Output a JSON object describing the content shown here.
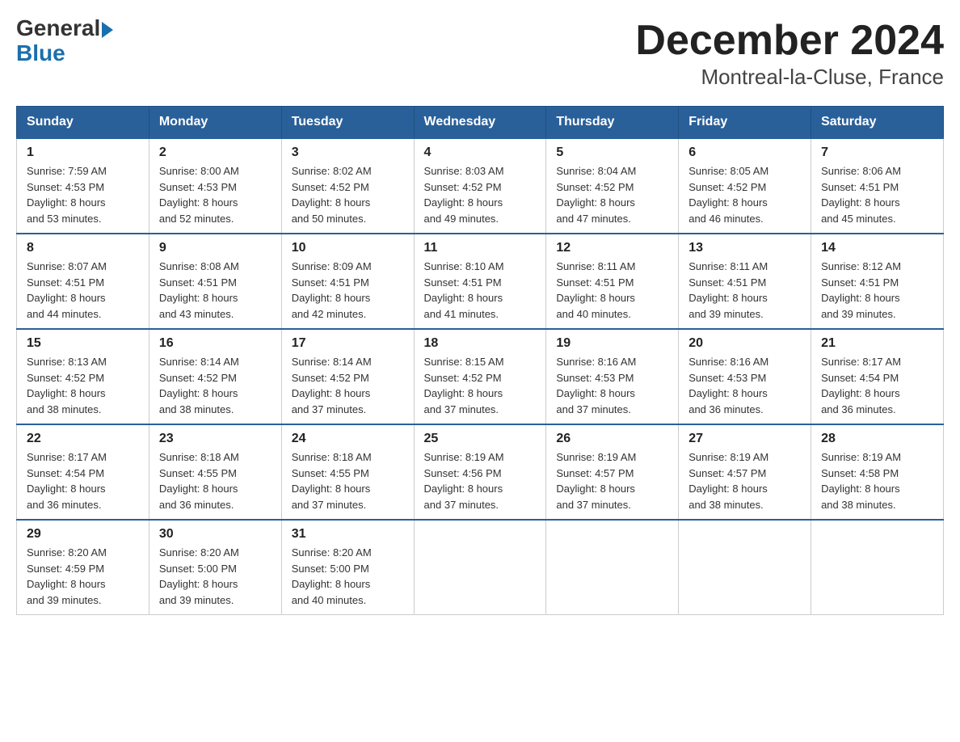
{
  "header": {
    "logo_general": "General",
    "logo_blue": "Blue",
    "title": "December 2024",
    "subtitle": "Montreal-la-Cluse, France"
  },
  "weekdays": [
    "Sunday",
    "Monday",
    "Tuesday",
    "Wednesday",
    "Thursday",
    "Friday",
    "Saturday"
  ],
  "weeks": [
    [
      {
        "day": "1",
        "sunrise": "Sunrise: 7:59 AM",
        "sunset": "Sunset: 4:53 PM",
        "daylight": "Daylight: 8 hours",
        "daylight2": "and 53 minutes."
      },
      {
        "day": "2",
        "sunrise": "Sunrise: 8:00 AM",
        "sunset": "Sunset: 4:53 PM",
        "daylight": "Daylight: 8 hours",
        "daylight2": "and 52 minutes."
      },
      {
        "day": "3",
        "sunrise": "Sunrise: 8:02 AM",
        "sunset": "Sunset: 4:52 PM",
        "daylight": "Daylight: 8 hours",
        "daylight2": "and 50 minutes."
      },
      {
        "day": "4",
        "sunrise": "Sunrise: 8:03 AM",
        "sunset": "Sunset: 4:52 PM",
        "daylight": "Daylight: 8 hours",
        "daylight2": "and 49 minutes."
      },
      {
        "day": "5",
        "sunrise": "Sunrise: 8:04 AM",
        "sunset": "Sunset: 4:52 PM",
        "daylight": "Daylight: 8 hours",
        "daylight2": "and 47 minutes."
      },
      {
        "day": "6",
        "sunrise": "Sunrise: 8:05 AM",
        "sunset": "Sunset: 4:52 PM",
        "daylight": "Daylight: 8 hours",
        "daylight2": "and 46 minutes."
      },
      {
        "day": "7",
        "sunrise": "Sunrise: 8:06 AM",
        "sunset": "Sunset: 4:51 PM",
        "daylight": "Daylight: 8 hours",
        "daylight2": "and 45 minutes."
      }
    ],
    [
      {
        "day": "8",
        "sunrise": "Sunrise: 8:07 AM",
        "sunset": "Sunset: 4:51 PM",
        "daylight": "Daylight: 8 hours",
        "daylight2": "and 44 minutes."
      },
      {
        "day": "9",
        "sunrise": "Sunrise: 8:08 AM",
        "sunset": "Sunset: 4:51 PM",
        "daylight": "Daylight: 8 hours",
        "daylight2": "and 43 minutes."
      },
      {
        "day": "10",
        "sunrise": "Sunrise: 8:09 AM",
        "sunset": "Sunset: 4:51 PM",
        "daylight": "Daylight: 8 hours",
        "daylight2": "and 42 minutes."
      },
      {
        "day": "11",
        "sunrise": "Sunrise: 8:10 AM",
        "sunset": "Sunset: 4:51 PM",
        "daylight": "Daylight: 8 hours",
        "daylight2": "and 41 minutes."
      },
      {
        "day": "12",
        "sunrise": "Sunrise: 8:11 AM",
        "sunset": "Sunset: 4:51 PM",
        "daylight": "Daylight: 8 hours",
        "daylight2": "and 40 minutes."
      },
      {
        "day": "13",
        "sunrise": "Sunrise: 8:11 AM",
        "sunset": "Sunset: 4:51 PM",
        "daylight": "Daylight: 8 hours",
        "daylight2": "and 39 minutes."
      },
      {
        "day": "14",
        "sunrise": "Sunrise: 8:12 AM",
        "sunset": "Sunset: 4:51 PM",
        "daylight": "Daylight: 8 hours",
        "daylight2": "and 39 minutes."
      }
    ],
    [
      {
        "day": "15",
        "sunrise": "Sunrise: 8:13 AM",
        "sunset": "Sunset: 4:52 PM",
        "daylight": "Daylight: 8 hours",
        "daylight2": "and 38 minutes."
      },
      {
        "day": "16",
        "sunrise": "Sunrise: 8:14 AM",
        "sunset": "Sunset: 4:52 PM",
        "daylight": "Daylight: 8 hours",
        "daylight2": "and 38 minutes."
      },
      {
        "day": "17",
        "sunrise": "Sunrise: 8:14 AM",
        "sunset": "Sunset: 4:52 PM",
        "daylight": "Daylight: 8 hours",
        "daylight2": "and 37 minutes."
      },
      {
        "day": "18",
        "sunrise": "Sunrise: 8:15 AM",
        "sunset": "Sunset: 4:52 PM",
        "daylight": "Daylight: 8 hours",
        "daylight2": "and 37 minutes."
      },
      {
        "day": "19",
        "sunrise": "Sunrise: 8:16 AM",
        "sunset": "Sunset: 4:53 PM",
        "daylight": "Daylight: 8 hours",
        "daylight2": "and 37 minutes."
      },
      {
        "day": "20",
        "sunrise": "Sunrise: 8:16 AM",
        "sunset": "Sunset: 4:53 PM",
        "daylight": "Daylight: 8 hours",
        "daylight2": "and 36 minutes."
      },
      {
        "day": "21",
        "sunrise": "Sunrise: 8:17 AM",
        "sunset": "Sunset: 4:54 PM",
        "daylight": "Daylight: 8 hours",
        "daylight2": "and 36 minutes."
      }
    ],
    [
      {
        "day": "22",
        "sunrise": "Sunrise: 8:17 AM",
        "sunset": "Sunset: 4:54 PM",
        "daylight": "Daylight: 8 hours",
        "daylight2": "and 36 minutes."
      },
      {
        "day": "23",
        "sunrise": "Sunrise: 8:18 AM",
        "sunset": "Sunset: 4:55 PM",
        "daylight": "Daylight: 8 hours",
        "daylight2": "and 36 minutes."
      },
      {
        "day": "24",
        "sunrise": "Sunrise: 8:18 AM",
        "sunset": "Sunset: 4:55 PM",
        "daylight": "Daylight: 8 hours",
        "daylight2": "and 37 minutes."
      },
      {
        "day": "25",
        "sunrise": "Sunrise: 8:19 AM",
        "sunset": "Sunset: 4:56 PM",
        "daylight": "Daylight: 8 hours",
        "daylight2": "and 37 minutes."
      },
      {
        "day": "26",
        "sunrise": "Sunrise: 8:19 AM",
        "sunset": "Sunset: 4:57 PM",
        "daylight": "Daylight: 8 hours",
        "daylight2": "and 37 minutes."
      },
      {
        "day": "27",
        "sunrise": "Sunrise: 8:19 AM",
        "sunset": "Sunset: 4:57 PM",
        "daylight": "Daylight: 8 hours",
        "daylight2": "and 38 minutes."
      },
      {
        "day": "28",
        "sunrise": "Sunrise: 8:19 AM",
        "sunset": "Sunset: 4:58 PM",
        "daylight": "Daylight: 8 hours",
        "daylight2": "and 38 minutes."
      }
    ],
    [
      {
        "day": "29",
        "sunrise": "Sunrise: 8:20 AM",
        "sunset": "Sunset: 4:59 PM",
        "daylight": "Daylight: 8 hours",
        "daylight2": "and 39 minutes."
      },
      {
        "day": "30",
        "sunrise": "Sunrise: 8:20 AM",
        "sunset": "Sunset: 5:00 PM",
        "daylight": "Daylight: 8 hours",
        "daylight2": "and 39 minutes."
      },
      {
        "day": "31",
        "sunrise": "Sunrise: 8:20 AM",
        "sunset": "Sunset: 5:00 PM",
        "daylight": "Daylight: 8 hours",
        "daylight2": "and 40 minutes."
      },
      null,
      null,
      null,
      null
    ]
  ]
}
